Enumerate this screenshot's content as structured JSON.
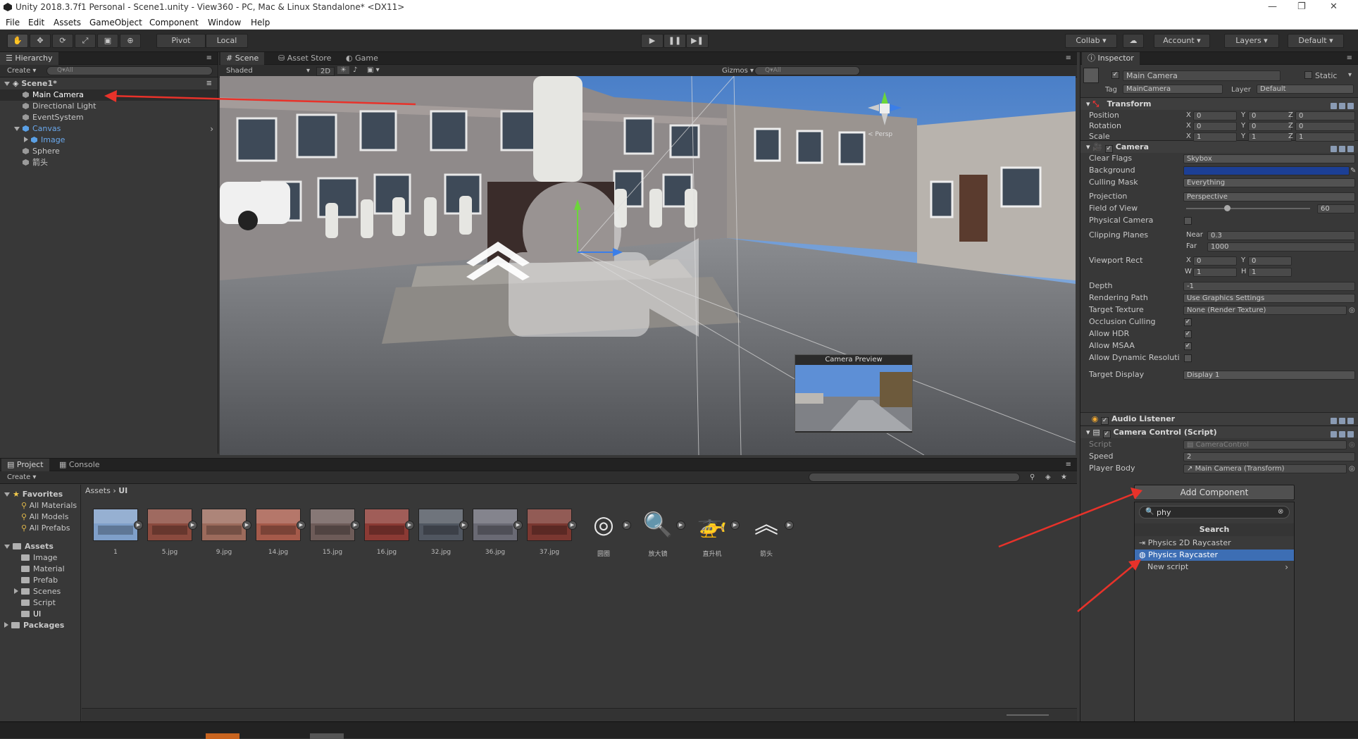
{
  "window": {
    "title": "Unity 2018.3.7f1 Personal - Scene1.unity - View360 - PC, Mac & Linux Standalone* <DX11>",
    "controls": [
      "—",
      "❐",
      "✕"
    ]
  },
  "menu": [
    "File",
    "Edit",
    "Assets",
    "GameObject",
    "Component",
    "Window",
    "Help"
  ],
  "toolbar": {
    "pivot": "Pivot",
    "local": "Local",
    "collab": "Collab ▾",
    "account": "Account",
    "layers": "Layers",
    "layout": "Default"
  },
  "hierarchy": {
    "tab": "Hierarchy",
    "create": "Create ▾",
    "search_placeholder": "Q▾All",
    "scene": "Scene1*",
    "items": [
      {
        "label": "Main Camera",
        "selected": true
      },
      {
        "label": "Directional Light"
      },
      {
        "label": "EventSystem"
      },
      {
        "label": "Canvas",
        "prefab": true
      },
      {
        "label": "Image",
        "prefab": true
      },
      {
        "label": "Sphere"
      },
      {
        "label": "箭头"
      }
    ]
  },
  "scene": {
    "tabs": [
      "Scene",
      "Asset Store",
      "Game"
    ],
    "shading": "Shaded",
    "mode_2d": "2D",
    "gizmos": "Gizmos ▾",
    "search_placeholder": "Q▾All",
    "persp": "< Persp",
    "camera_preview": "Camera Preview"
  },
  "inspector": {
    "tab": "Inspector",
    "object_name": "Main Camera",
    "static": "Static",
    "tag_label": "Tag",
    "tag": "MainCamera",
    "layer_label": "Layer",
    "layer": "Default",
    "transform": {
      "title": "Transform",
      "rows": [
        {
          "label": "Position",
          "x": "0",
          "y": "0",
          "z": "0"
        },
        {
          "label": "Rotation",
          "x": "0",
          "y": "0",
          "z": "0"
        },
        {
          "label": "Scale",
          "x": "1",
          "y": "1",
          "z": "1"
        }
      ]
    },
    "camera": {
      "title": "Camera",
      "clear_flags_label": "Clear Flags",
      "clear_flags": "Skybox",
      "background_label": "Background",
      "culling_mask_label": "Culling Mask",
      "culling_mask": "Everything",
      "projection_label": "Projection",
      "projection": "Perspective",
      "fov_label": "Field of View",
      "fov": "60",
      "physical_label": "Physical Camera",
      "clipping_label": "Clipping Planes",
      "near_label": "Near",
      "near": "0.3",
      "far_label": "Far",
      "far": "1000",
      "viewport_label": "Viewport Rect",
      "vx": "0",
      "vy": "0",
      "vw": "1",
      "vh": "1",
      "depth_label": "Depth",
      "depth": "-1",
      "rendering_label": "Rendering Path",
      "rendering": "Use Graphics Settings",
      "target_texture_label": "Target Texture",
      "target_texture": "None (Render Texture)",
      "occlusion_label": "Occlusion Culling",
      "hdr_label": "Allow HDR",
      "msaa_label": "Allow MSAA",
      "dynres_label": "Allow Dynamic Resoluti",
      "display_label": "Target Display",
      "display": "Display 1"
    },
    "audio_listener": "Audio Listener",
    "camera_control": {
      "title": "Camera Control (Script)",
      "script_label": "Script",
      "script": "CameraControl",
      "speed_label": "Speed",
      "speed": "2",
      "player_label": "Player Body",
      "player": "Main Camera (Transform)"
    }
  },
  "add_component": {
    "button": "Add Component",
    "search_value": "phy",
    "header": "Search",
    "results": [
      {
        "label": "Physics 2D Raycaster"
      },
      {
        "label": "Physics Raycaster",
        "selected": true
      },
      {
        "label": "New script"
      }
    ]
  },
  "project": {
    "tabs": [
      "Project",
      "Console"
    ],
    "create": "Create ▾",
    "breadcrumb": [
      "Assets",
      "UI"
    ],
    "favorites": {
      "title": "Favorites",
      "items": [
        "All Materials",
        "All Models",
        "All Prefabs"
      ]
    },
    "assets": {
      "title": "Assets",
      "items": [
        "Image",
        "Material",
        "Prefab",
        "Scenes",
        "Script",
        "UI"
      ]
    },
    "packages": "Packages",
    "files": [
      "1",
      "5.jpg",
      "9.jpg",
      "14.jpg",
      "15.jpg",
      "16.jpg",
      "32.jpg",
      "36.jpg",
      "37.jpg",
      "圆圈",
      "放大镜",
      "直升机",
      "箭头"
    ]
  },
  "colors": {
    "background_color": "#1c3f95",
    "selection": "#3d6eb4",
    "annotation_arrow": "#e8322a"
  }
}
